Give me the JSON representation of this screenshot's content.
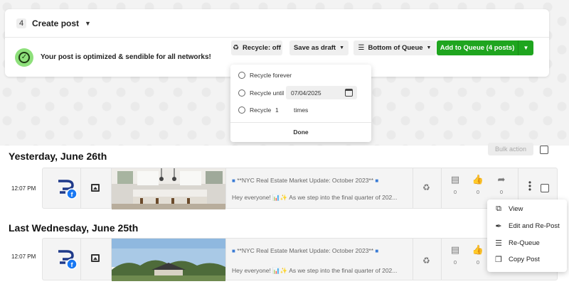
{
  "create_post": {
    "step": "4",
    "title": "Create post",
    "optimized_message": "Your post is optimized & sendible for all networks!",
    "recycle_button": "Recycle: off",
    "save_draft_button": "Save as draft",
    "queue_position_button": "Bottom of Queue",
    "add_to_queue_button": "Add to Queue (4 posts)"
  },
  "recycle_menu": {
    "option_forever": "Recycle forever",
    "option_until": "Recycle until",
    "until_date": "07/04/2025",
    "option_times": "Recycle",
    "times_value": "1",
    "times_label": "times",
    "done": "Done"
  },
  "bulk_action": "Bulk action",
  "days": [
    {
      "heading": "Yesterday, June 26th",
      "post": {
        "time": "12:07 PM",
        "title": "**NYC Real Estate Market Update: October 2023**",
        "text": "Hey everyone! 📊✨ As we step into the final quarter of 202...",
        "comments": "0",
        "likes": "0",
        "shares": "0"
      }
    },
    {
      "heading": "Last Wednesday, June 25th",
      "post": {
        "time": "12:07 PM",
        "title": "**NYC Real Estate Market Update: October 2023**",
        "text": "Hey everyone! 📊✨ As we step into the final quarter of 202...",
        "comments": "0",
        "likes": "0",
        "shares": "0"
      }
    }
  ],
  "context_menu": {
    "view": "View",
    "edit_repost": "Edit and Re-Post",
    "requeue": "Re-Queue",
    "copy": "Copy Post"
  },
  "colors": {
    "primary_green": "#1fa51f",
    "optimized_badge": "#8ee07b",
    "brand_blue": "#1f3a8a",
    "facebook_blue": "#1877f2"
  }
}
